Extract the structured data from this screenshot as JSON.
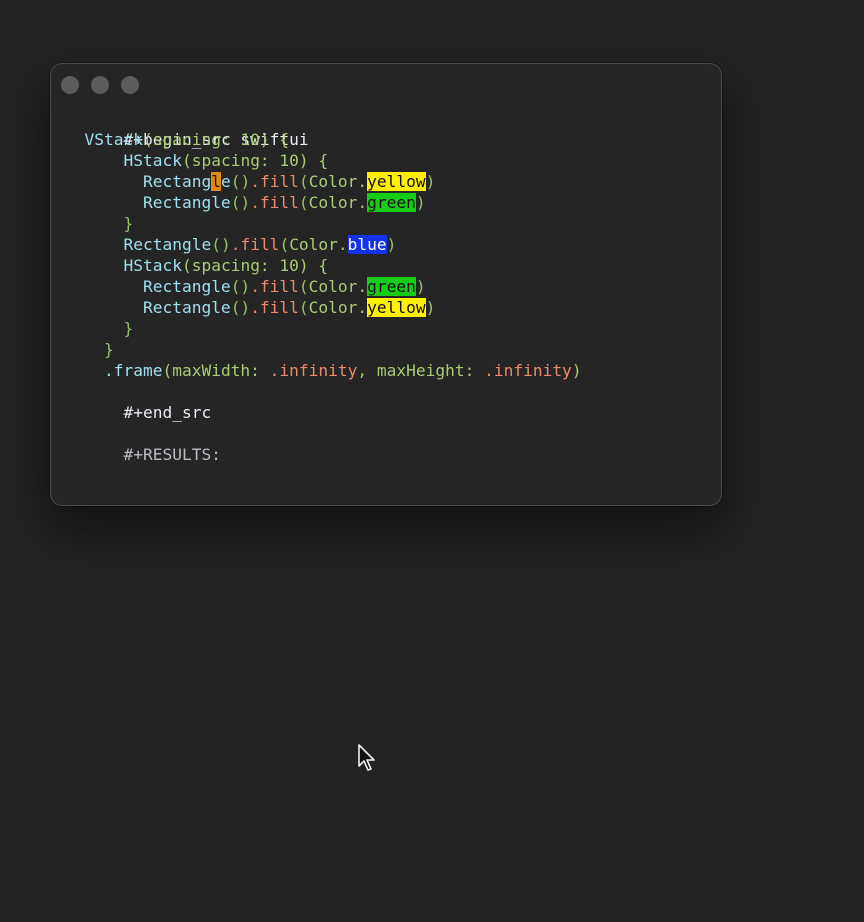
{
  "editor": {
    "begin_src": "#+begin_src swiftui",
    "vstack": "VStack",
    "hstack": "HStack",
    "spacing_open": "(spacing: 10) {",
    "rectangle": "Rectangle",
    "rect_prefix": "Rectang",
    "rect_cursor_char": "l",
    "rect_suffix": "e",
    "fill_call": "().fill(",
    "color_prefix": "Color.",
    "color_yellow": "yellow",
    "color_green": "green",
    "color_blue": "blue",
    "close_paren": ")",
    "close_brace": "}",
    "frame_modifier": ".frame",
    "frame_open": "(maxWidth: ",
    "infinity": ".infinity",
    "frame_mid": ", maxHeight: ",
    "end_src": "#+end_src",
    "results": "#+RESULTS:"
  },
  "colors": {
    "background": "#232323",
    "window": "#252525",
    "highlight_yellow": "#ffef00",
    "highlight_green": "#17cc17",
    "highlight_blue": "#1433e8",
    "cursor": "#e08a12"
  },
  "icons": {
    "traffic_lights": "window-control-dots",
    "pointer": "mouse-pointer-icon"
  }
}
